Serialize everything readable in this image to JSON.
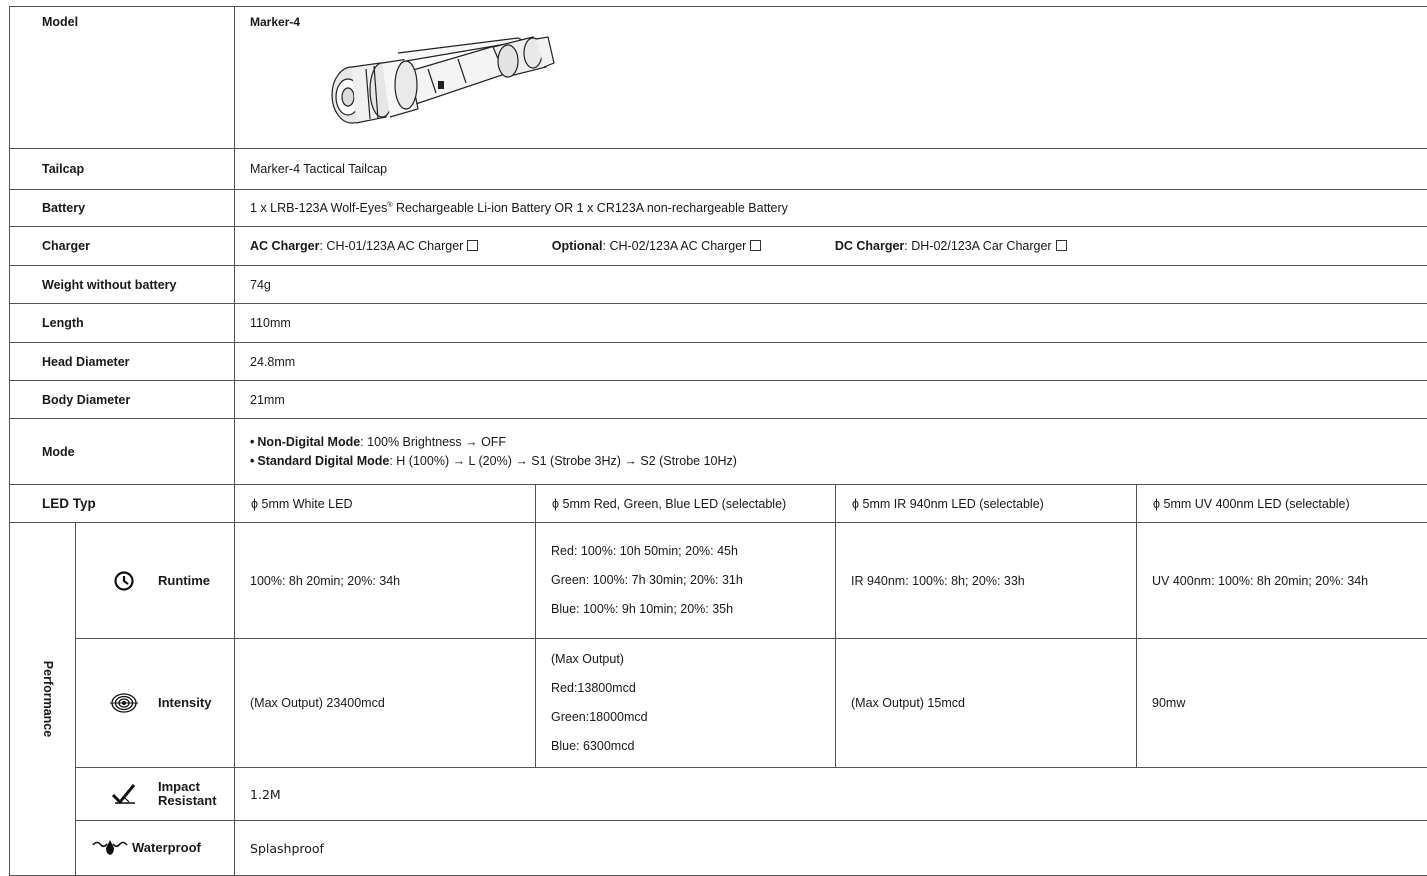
{
  "model": {
    "label": "Model",
    "value": "Marker-4"
  },
  "tailcap": {
    "label": "Tailcap",
    "value": "Marker-4 Tactical Tailcap"
  },
  "battery": {
    "label": "Battery",
    "part1": "1 x LRB-123A Wolf-Eyes",
    "reg": "®",
    "part2": " Rechargeable Li-ion Battery  OR  1 x CR123A non-rechargeable Battery"
  },
  "charger": {
    "label": "Charger",
    "ac_label": "AC Charger",
    "ac_value": ": CH-01/123A AC Charger",
    "opt_label": "Optional",
    "opt_value": ": CH-02/123A AC Charger",
    "dc_label": "DC Charger",
    "dc_value": ": DH-02/123A Car Charger"
  },
  "weight": {
    "label": "Weight without battery",
    "value": "74g"
  },
  "length": {
    "label": "Length",
    "value": "110mm"
  },
  "head_diameter": {
    "label": "Head Diameter",
    "value": "24.8mm"
  },
  "body_diameter": {
    "label": "Body Diameter",
    "value": "21mm"
  },
  "mode": {
    "label": "Mode",
    "bullet": "•",
    "nd_label": "Non-Digital Mode",
    "nd_value": ":  100% Brightness → OFF",
    "sd_label": "Standard Digital Mode",
    "sd_value": ":  H (100%) → L (20%) → S1 (Strobe 3Hz) → S2 (Strobe 10Hz)"
  },
  "led_typ": {
    "label": "LED Typ",
    "options": [
      "ϕ 5mm White LED",
      "ϕ 5mm Red, Green, Blue LED (selectable)",
      "ϕ 5mm IR 940nm LED (selectable)",
      "ϕ 5mm UV 400nm LED (selectable)"
    ]
  },
  "performance": {
    "label": "Performance",
    "runtime": {
      "label": "Runtime",
      "white": "100%: 8h 20min;  20%: 34h",
      "rgb": [
        "Red:  100%: 10h 50min;  20%: 45h",
        "Green: 100%: 7h 30min;  20%: 31h",
        "Blue:  100%: 9h 10min;  20%: 35h"
      ],
      "ir": "IR 940nm:  100%: 8h;  20%: 33h",
      "uv": "UV 400nm:  100%: 8h 20min;  20%: 34h"
    },
    "intensity": {
      "label": "Intensity",
      "white": "(Max Output) 23400mcd",
      "rgb": [
        "(Max Output)",
        "Red:13800mcd",
        "Green:18000mcd",
        "Blue: 6300mcd"
      ],
      "ir": "(Max Output) 15mcd",
      "uv": "90mw"
    },
    "impact": {
      "label_line1": "Impact",
      "label_line2": "Resistant",
      "value": "1.2M"
    },
    "waterproof": {
      "label": "Waterproof",
      "value": "Splashproof"
    }
  }
}
